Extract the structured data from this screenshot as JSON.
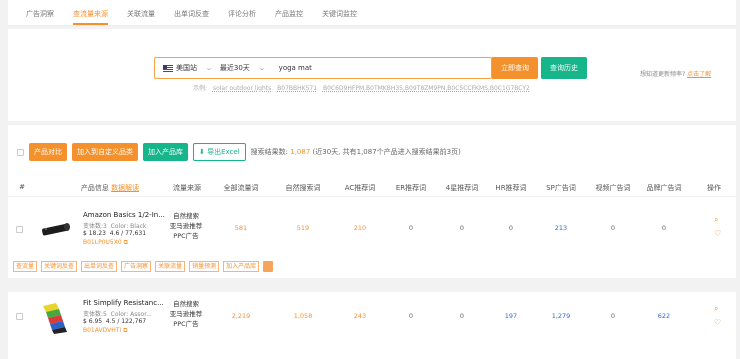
{
  "tabs": [
    "广告洞察",
    "查流量来源",
    "关联流量",
    "出单词反查",
    "评论分析",
    "产品监控",
    "关键词监控"
  ],
  "search": {
    "marketplace": "美国站",
    "period": "最近30天",
    "keyword": "yoga mat",
    "query_button": "立即查询",
    "history_button": "查询历史",
    "examples_label": "示例:",
    "examples": [
      "solar outdoor lights",
      "B07BBHK571",
      "B0C6D9HFPM,B0TMKBH35,B09T8ZM9PN,B0C5CCFKMS,B0C1G7BCY2"
    ],
    "tip_prefix": "想知道更新频率?",
    "tip_link": "点击了解"
  },
  "toolbar": {
    "compare": "产品对比",
    "add_category": "加入到自定义品类",
    "add_library": "加入产品库",
    "export": "导出Excel",
    "stats_prefix": "搜索结果数:",
    "stats_count": "1,087",
    "stats_suffix": "(近30天, 共有1,087个产品进入搜索结果前3页)"
  },
  "columns": {
    "index": "#",
    "product": "产品信息",
    "sort_link": "数据解读",
    "traffic_source": "流量来源",
    "total_words": "全部流量词",
    "organic": "自然搜索词",
    "ac": "AC推荐词",
    "er": "ER推荐词",
    "four_star": "4星推荐词",
    "hr": "HR推荐词",
    "sp": "SP广告词",
    "video": "视频广告词",
    "brand": "品牌广告词",
    "action": "操作"
  },
  "rows": [
    {
      "title": "Amazon Basics 1/2-In...",
      "variants": "变体数:3",
      "color": "Color: Black",
      "price": "$ 18.23",
      "rating": "4.6 / 77,631",
      "asin": "B01LP0U5X0",
      "sources": [
        "自然搜索",
        "亚马逊推荐",
        "PPC广告"
      ],
      "values": [
        "581",
        "519",
        "210",
        "0",
        "0",
        "0",
        "213",
        "0",
        "0"
      ]
    },
    {
      "title": "Fit Simplify Resistanc...",
      "variants": "变体数:5",
      "color": "Color: Assor...",
      "price": "$ 6.95",
      "rating": "4.5 / 122,767",
      "asin": "B01AVDVHTI",
      "sources": [
        "自然搜索",
        "亚马逊推荐",
        "PPC广告"
      ],
      "values": [
        "2,219",
        "1,058",
        "243",
        "0",
        "0",
        "197",
        "1,279",
        "0",
        "622"
      ]
    }
  ],
  "row_actions": [
    "查流量",
    "关键词反查",
    "出单词反查",
    "广告洞察",
    "关联流量",
    "销量预测",
    "加入产品库"
  ],
  "colors": {
    "accent": "#f5912c",
    "green": "#17b58a",
    "blue": "#2d6bd6"
  }
}
